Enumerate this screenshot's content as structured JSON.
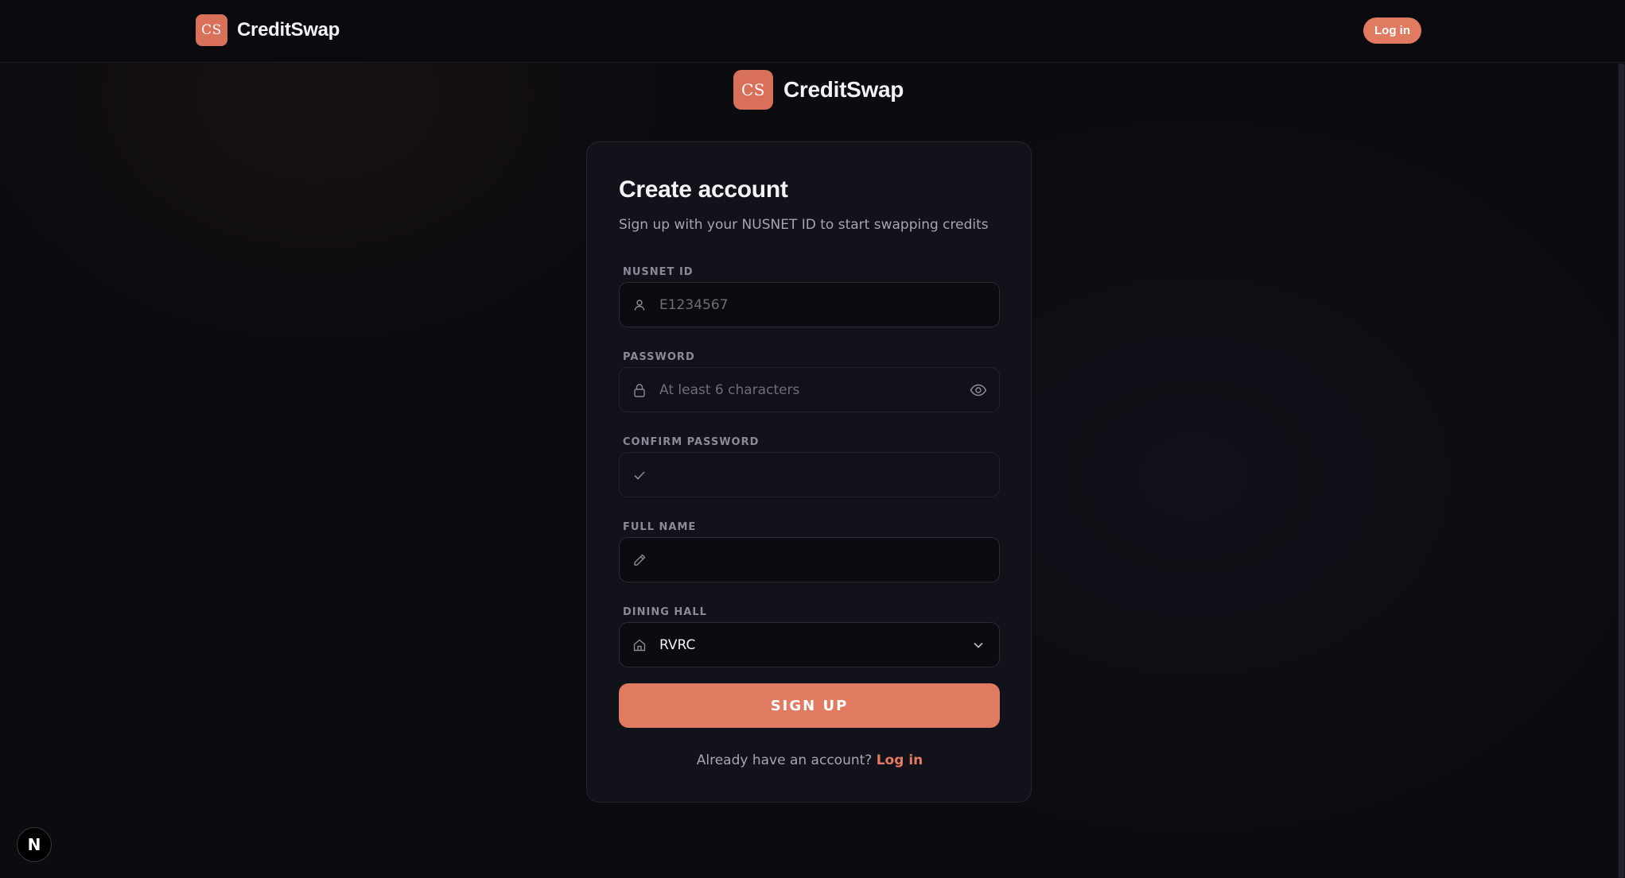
{
  "navbar": {
    "logo_text": "CS",
    "brand": "CreditSwap",
    "login_label": "Log in"
  },
  "center_brand": {
    "logo_text": "CS",
    "brand": "CreditSwap"
  },
  "card": {
    "title": "Create account",
    "subtitle": "Sign up with your NUSNET ID to start swapping credits",
    "fields": {
      "nusnet": {
        "label": "NUSNET ID",
        "placeholder": "E1234567",
        "value": ""
      },
      "password": {
        "label": "PASSWORD",
        "placeholder": "At least 6 characters",
        "value": ""
      },
      "confirm": {
        "label": "CONFIRM PASSWORD",
        "placeholder": "",
        "value": ""
      },
      "fullname": {
        "label": "FULL NAME",
        "placeholder": "",
        "value": ""
      },
      "dining": {
        "label": "DINING HALL",
        "value": "RVRC"
      }
    },
    "signup_label": "SIGN UP",
    "footer_text": "Already have an account?",
    "footer_link": "Log in"
  },
  "next_badge": {
    "letter": "N"
  },
  "icons": {
    "nusnet": "user-icon",
    "password": "lock-icon",
    "password_toggle": "eye-icon",
    "confirm": "check-icon",
    "fullname": "pencil-icon",
    "dining": "home-icon",
    "dropdown": "chevron-down-icon"
  },
  "colors": {
    "accent": "#e07a61",
    "background": "#0b0b10",
    "card": "#12121a"
  }
}
